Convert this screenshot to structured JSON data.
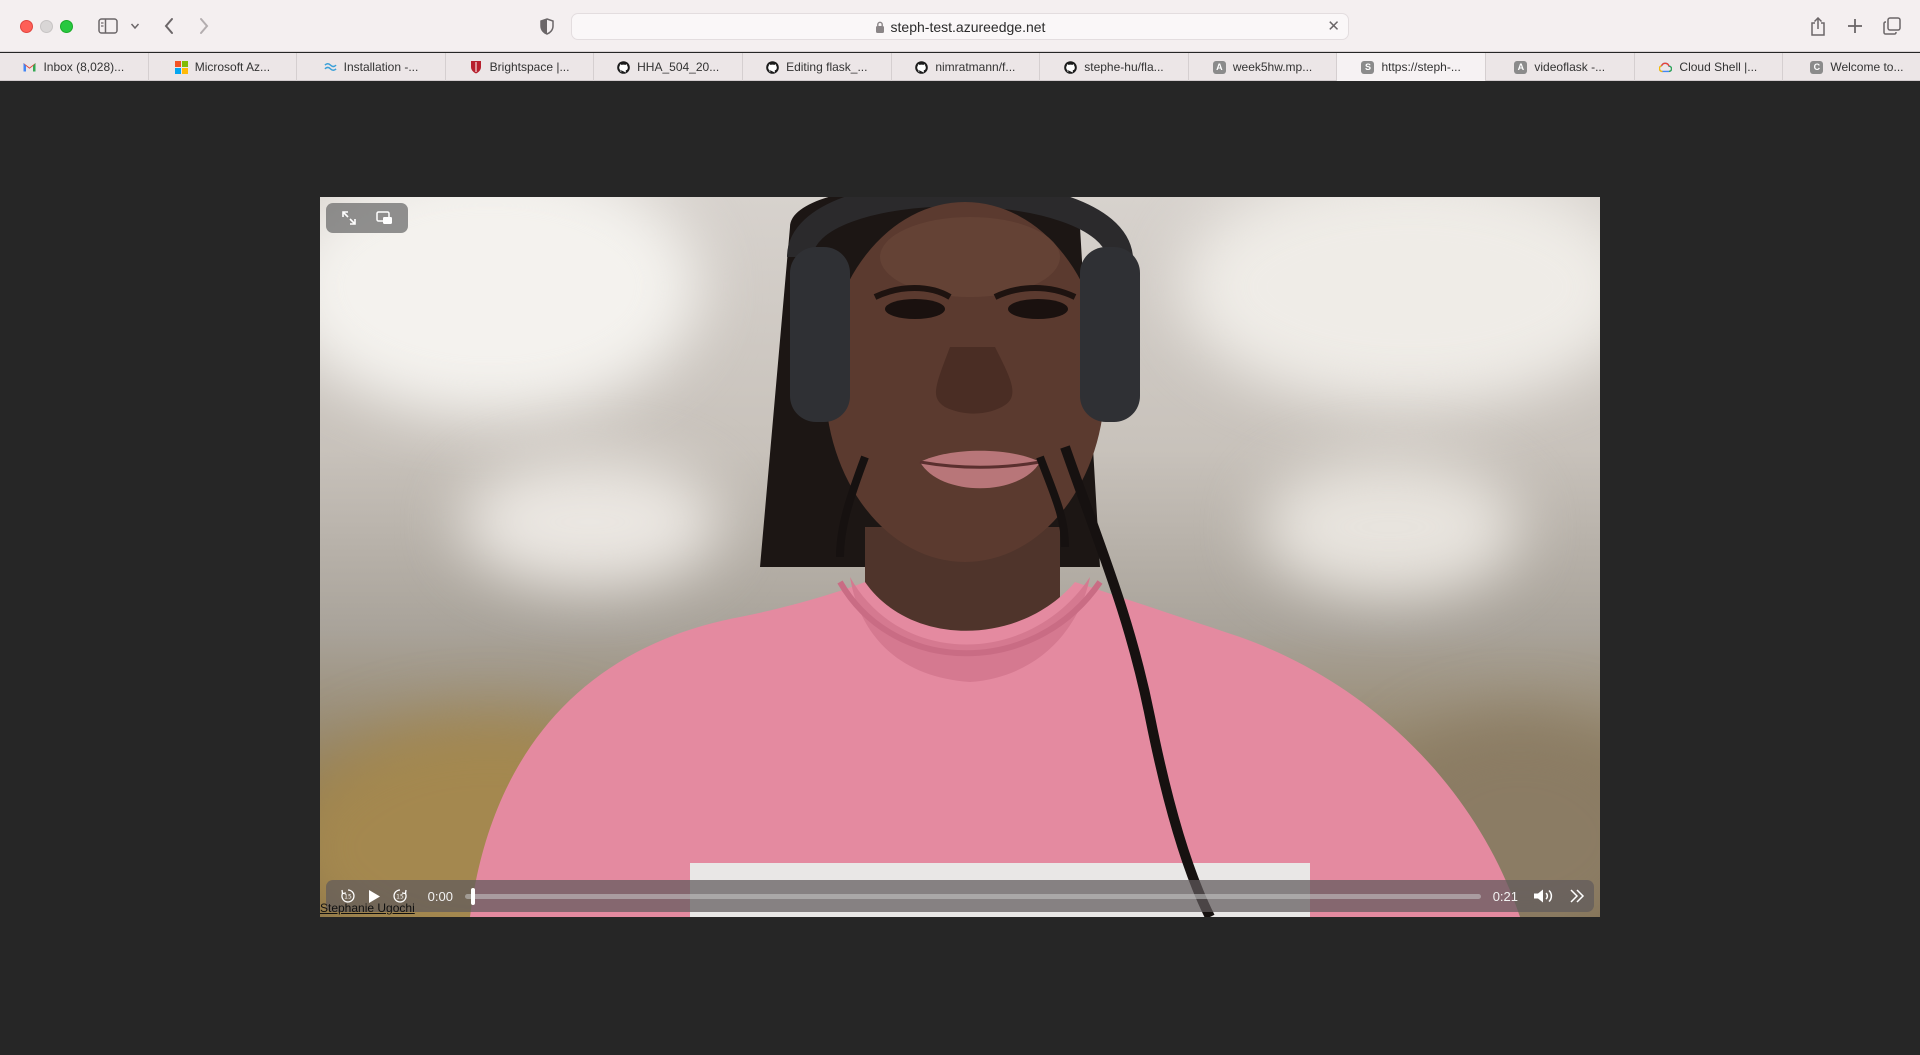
{
  "browser": {
    "url": "steph-test.azureedge.net",
    "tabs": [
      {
        "label": "Inbox (8,028)...",
        "icon": "gmail-icon",
        "active": false
      },
      {
        "label": "Microsoft Az...",
        "icon": "microsoft-icon",
        "active": false
      },
      {
        "label": "Installation -...",
        "icon": "flask-docs-icon",
        "active": false
      },
      {
        "label": "Brightspace |...",
        "icon": "shield-crest-icon",
        "active": false
      },
      {
        "label": "HHA_504_20...",
        "icon": "github-icon",
        "active": false
      },
      {
        "label": "Editing flask_...",
        "icon": "github-icon",
        "active": false
      },
      {
        "label": "nimratmann/f...",
        "icon": "github-icon",
        "active": false
      },
      {
        "label": "stephe-hu/fla...",
        "icon": "github-icon",
        "active": false
      },
      {
        "label": "week5hw.mp...",
        "icon": "letter-a-icon",
        "letter": "A",
        "active": false
      },
      {
        "label": "https://steph-...",
        "icon": "letter-s-icon",
        "letter": "S",
        "active": true
      },
      {
        "label": "videoflask -...",
        "icon": "letter-a-icon",
        "letter": "A",
        "active": false
      },
      {
        "label": "Cloud Shell  |...",
        "icon": "google-cloud-icon",
        "active": false
      },
      {
        "label": "Welcome to...",
        "icon": "letter-c-icon",
        "letter": "C",
        "active": false
      }
    ]
  },
  "player": {
    "current_time": "0:00",
    "duration": "0:21",
    "progress": 0.0
  },
  "caption": "Stephanie Ugochi",
  "colors": {
    "page_background": "#262626",
    "toolbar_background": "#f4eff0",
    "sweater": "#e48aa0"
  }
}
